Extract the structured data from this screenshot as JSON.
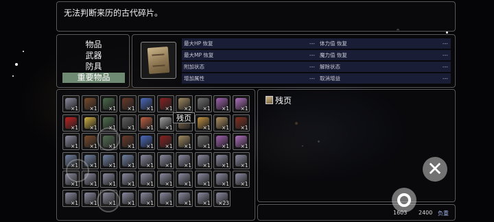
{
  "description": {
    "text": "无法判断来历的古代碎片。"
  },
  "categories": [
    {
      "label": "物品",
      "selected": false
    },
    {
      "label": "武器",
      "selected": false
    },
    {
      "label": "防具",
      "selected": false
    },
    {
      "label": "重要物品",
      "selected": true
    }
  ],
  "stats": [
    {
      "label": "最大HP 恢复",
      "value": "---"
    },
    {
      "label": "体力值 恢复",
      "value": "---"
    },
    {
      "label": "最大MP 恢复",
      "value": "---"
    },
    {
      "label": "魔力值 恢复",
      "value": "---"
    },
    {
      "label": "附加状态",
      "value": "---"
    },
    {
      "label": "解除状态",
      "value": "---"
    },
    {
      "label": "增加属性",
      "value": "---"
    },
    {
      "label": "取消增益",
      "value": "---"
    }
  ],
  "tooltip": {
    "text": "残页"
  },
  "detail": {
    "name": "残页"
  },
  "weight": {
    "current": "1603",
    "max": "2400",
    "label": "负重"
  },
  "inventory": [
    [
      "×1",
      "×1",
      "×1",
      "×1",
      "×1",
      "×1",
      "×2",
      "×1",
      "×1",
      "×1"
    ],
    [
      "×1",
      "×1",
      "×1",
      "×1",
      "×1",
      "×1",
      "",
      "×1",
      "×1",
      "×1"
    ],
    [
      "×1",
      "×1",
      "×1",
      "×1",
      "×1",
      "×1",
      "×1",
      "×1",
      "×1",
      "×1"
    ],
    [
      "×1",
      "×1",
      "×1",
      "×1",
      "×1",
      "×1",
      "×1",
      "×1",
      "×1",
      "×1"
    ],
    [
      "×1",
      "×1",
      "×1",
      "×1",
      "×1",
      "×1",
      "×1",
      "×1",
      "×1",
      "×1"
    ],
    [
      "×1",
      "×1",
      "×1",
      "×1",
      "×1",
      "×1",
      "×1",
      "×1",
      "×23",
      ""
    ]
  ],
  "colors": {
    "selected_category": "#6f8a73",
    "stat_row": "#28305a",
    "weight_label": "#9fb4e8"
  },
  "icons": {
    "close": "close-icon",
    "confirm": "circle-confirm-icon",
    "item": "scroll-page-icon"
  }
}
